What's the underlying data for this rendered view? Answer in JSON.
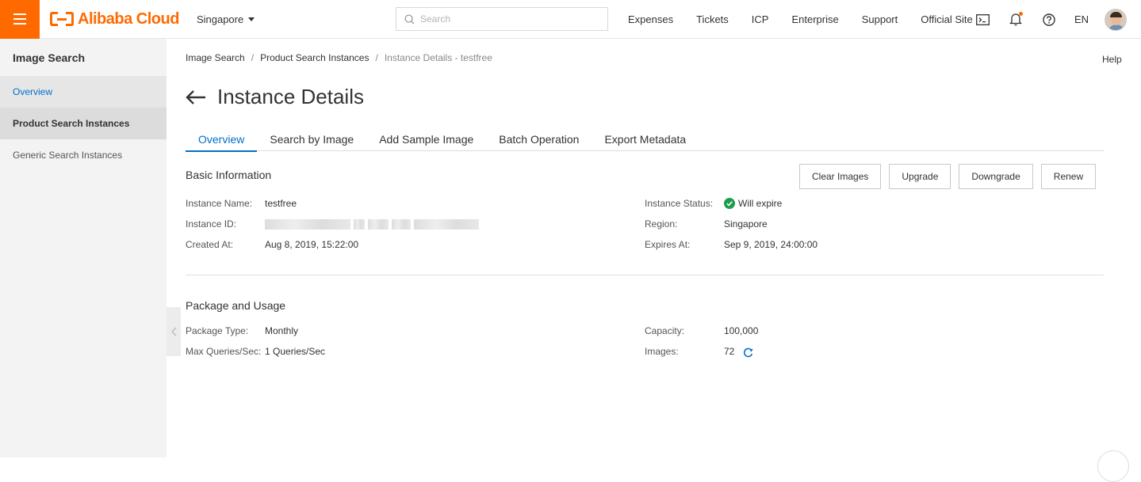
{
  "topbar": {
    "brand": "Alibaba Cloud",
    "region": "Singapore",
    "search_placeholder": "Search",
    "links": [
      "Expenses",
      "Tickets",
      "ICP",
      "Enterprise",
      "Support",
      "Official Site"
    ],
    "lang": "EN",
    "accent": "#ff6a00"
  },
  "sidebar": {
    "title": "Image Search",
    "items": [
      {
        "label": "Overview"
      },
      {
        "label": "Product Search Instances"
      },
      {
        "label": "Generic Search Instances"
      }
    ]
  },
  "breadcrumb": {
    "items": [
      "Image Search",
      "Product Search Instances",
      "Instance Details - testfree"
    ]
  },
  "help": "Help",
  "page_title": "Instance Details",
  "tabs": [
    {
      "label": "Overview",
      "active": true
    },
    {
      "label": "Search by Image"
    },
    {
      "label": "Add Sample Image"
    },
    {
      "label": "Batch Operation"
    },
    {
      "label": "Export Metadata"
    }
  ],
  "basic": {
    "title": "Basic Information",
    "buttons": [
      "Clear Images",
      "Upgrade",
      "Downgrade",
      "Renew"
    ],
    "name_label": "Instance Name:",
    "name_value": "testfree",
    "id_label": "Instance ID:",
    "created_label": "Created At:",
    "created_value": "Aug 8, 2019, 15:22:00",
    "status_label": "Instance Status:",
    "status_value": "Will expire",
    "region_label": "Region:",
    "region_value": "Singapore",
    "expires_label": "Expires At:",
    "expires_value": "Sep 9, 2019, 24:00:00"
  },
  "package": {
    "title": "Package and Usage",
    "type_label": "Package Type:",
    "type_value": "Monthly",
    "qps_label": "Max Queries/Sec:",
    "qps_value": "1 Queries/Sec",
    "capacity_label": "Capacity:",
    "capacity_value": "100,000",
    "images_label": "Images:",
    "images_value": "72"
  },
  "colors": {
    "link": "#0070cc",
    "success": "#1e9d4d"
  }
}
